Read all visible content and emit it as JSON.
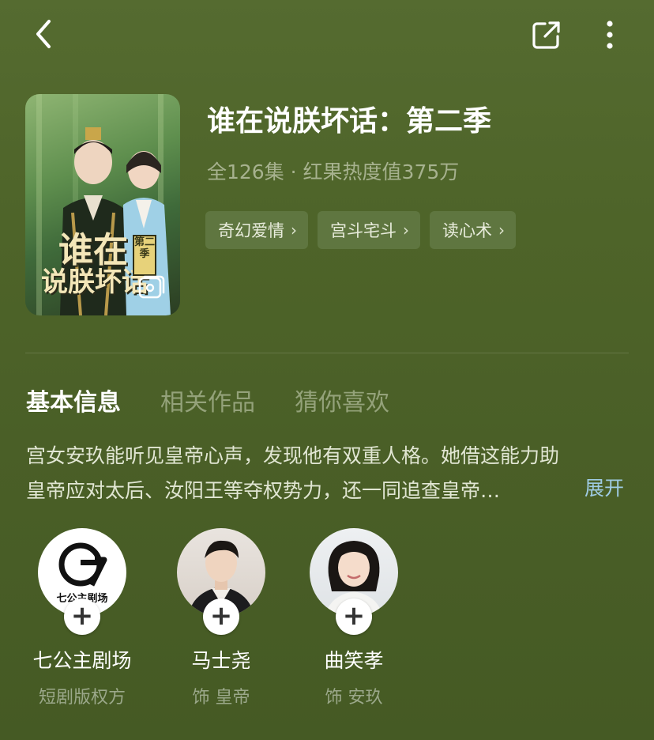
{
  "topbar": {
    "back_icon": "chevron-left-icon",
    "share_icon": "share-icon",
    "more_icon": "more-vertical-icon"
  },
  "poster": {
    "title_line1": "谁在",
    "title_line2": "说朕坏话",
    "season_badge": "第二季",
    "gallery_icon": "gallery-icon"
  },
  "show": {
    "title": "谁在说朕坏话：第二季",
    "meta": "全126集 · 红果热度值375万",
    "tags": [
      {
        "label": "奇幻爱情",
        "icon": "chevron-right-icon"
      },
      {
        "label": "宫斗宅斗",
        "icon": "chevron-right-icon"
      },
      {
        "label": "读心术",
        "icon": "chevron-right-icon"
      }
    ]
  },
  "tabs": [
    {
      "label": "基本信息",
      "active": true
    },
    {
      "label": "相关作品",
      "active": false
    },
    {
      "label": "猜你喜欢",
      "active": false
    }
  ],
  "description": {
    "line1": "宫女安玖能听见皇帝心声，发现他有双重人格。她借这能力助",
    "line2": "皇帝应对太后、汝阳王等夺权势力，还一同追查皇帝…",
    "expand_label": "展开"
  },
  "people": [
    {
      "name": "七公主剧场",
      "role": "短剧版权方",
      "avatar_text": "七公主剧场"
    },
    {
      "name": "马士尧",
      "role": "饰 皇帝"
    },
    {
      "name": "曲笑孝",
      "role": "饰 安玖"
    }
  ],
  "colors": {
    "background": "#4e6429",
    "tag_bg": "#5f7640",
    "expand_link": "#9fcbe3",
    "muted_text": "#a7b28f"
  }
}
